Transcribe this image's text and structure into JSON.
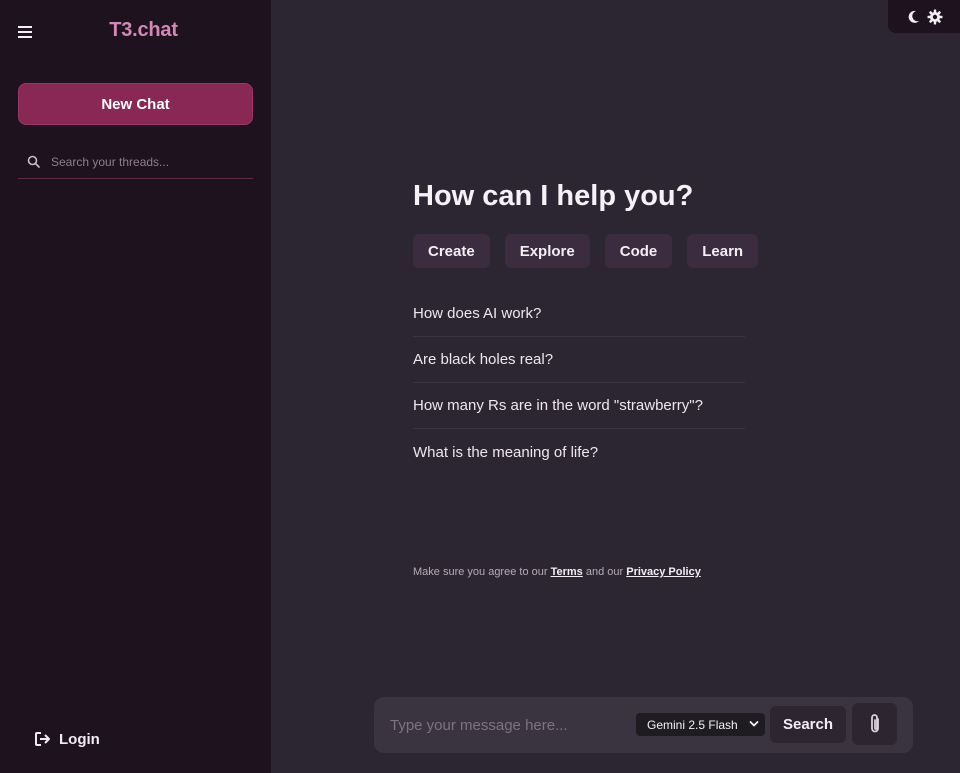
{
  "sidebar": {
    "brand": "T3.chat",
    "new_chat_label": "New Chat",
    "search_placeholder": "Search your threads...",
    "login_label": "Login"
  },
  "main": {
    "title": "How can I help you?",
    "pills": [
      {
        "label": "Create"
      },
      {
        "label": "Explore"
      },
      {
        "label": "Code"
      },
      {
        "label": "Learn"
      }
    ],
    "suggestions": [
      "How does AI work?",
      "Are black holes real?",
      "How many Rs are in the word \"strawberry\"?",
      "What is the meaning of life?"
    ],
    "legal": {
      "prefix": "Make sure you agree to our",
      "terms": "Terms",
      "middle": "and our",
      "privacy": "Privacy Policy"
    }
  },
  "composer": {
    "placeholder": "Type your message here...",
    "model": "Gemini 2.5 Flash",
    "search_label": "Search"
  },
  "icons": {
    "menu": "hamburger-icon",
    "search": "search-icon",
    "login": "sign-in-icon",
    "theme": "moon-icon",
    "settings": "gear-icon",
    "attach": "paperclip-icon",
    "model_dropdown": "chevron-down-icon"
  },
  "colors": {
    "brand": "#d387b6",
    "accent": "#8a2855",
    "sidebar_bg": "#1d121d",
    "main_bg": "#2b2631"
  }
}
